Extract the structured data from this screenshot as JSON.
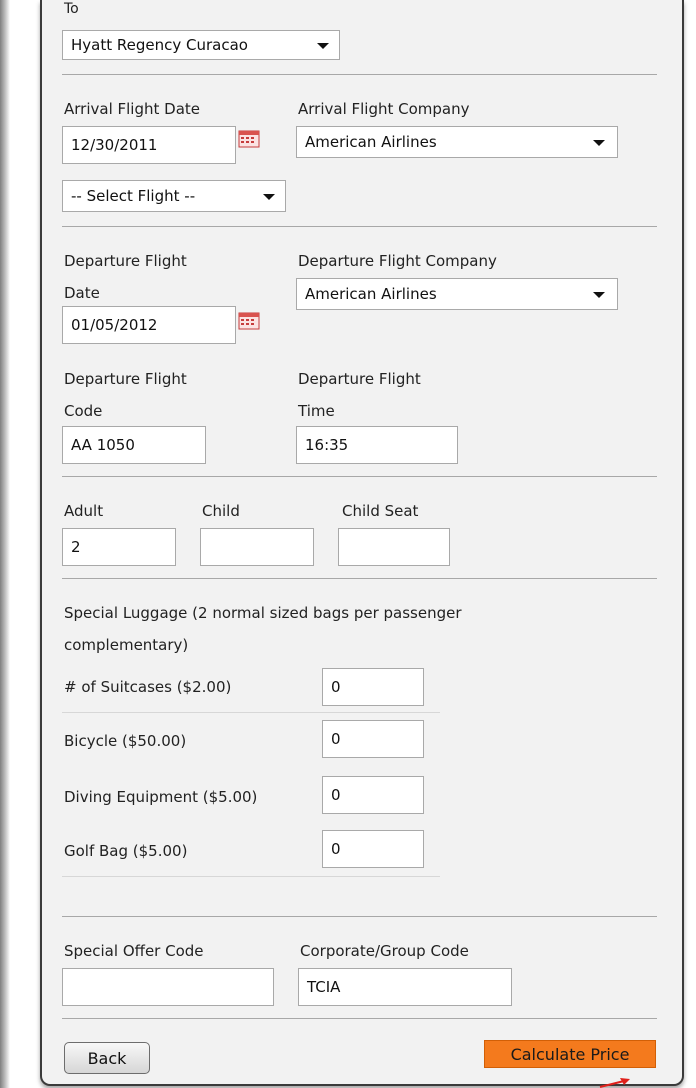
{
  "to": {
    "label": "To",
    "selected": "Hyatt Regency Curacao"
  },
  "arrival": {
    "date_label": "Arrival Flight Date",
    "date_value": "12/30/2011",
    "company_label": "Arrival Flight Company",
    "company_value": "American Airlines",
    "flight_select": "-- Select Flight --"
  },
  "departure": {
    "date_label_1": "Departure Flight",
    "date_label_2": "Date",
    "date_value": "01/05/2012",
    "company_label": "Departure Flight Company",
    "company_value": "American Airlines",
    "code_label_1": "Departure Flight",
    "code_label_2": "Code",
    "code_value": "AA 1050",
    "time_label_1": "Departure Flight",
    "time_label_2": "Time",
    "time_value": "16:35"
  },
  "passengers": {
    "adult_label": "Adult",
    "adult_value": "2",
    "child_label": "Child",
    "child_value": "",
    "child_seat_label": "Child Seat",
    "child_seat_value": ""
  },
  "luggage": {
    "intro_1": "Special Luggage (2 normal sized bags per passenger",
    "intro_2": "complementary)",
    "items": [
      {
        "label": "# of Suitcases ($2.00)",
        "value": "0"
      },
      {
        "label": "Bicycle ($50.00)",
        "value": "0"
      },
      {
        "label": "Diving Equipment ($5.00)",
        "value": "0"
      },
      {
        "label": "Golf Bag ($5.00)",
        "value": "0"
      }
    ]
  },
  "codes": {
    "offer_label": "Special Offer Code",
    "offer_value": "",
    "corporate_label": "Corporate/Group Code",
    "corporate_value": "TCIA"
  },
  "actions": {
    "back_label": "Back",
    "calculate_label": "Calculate Price"
  },
  "colors": {
    "accent": "#f47a1d",
    "arrow": "#e0201b",
    "calendar": "#d9534f"
  },
  "icons": {
    "calendar": "calendar-icon",
    "dropdown": "chevron-down-icon"
  }
}
